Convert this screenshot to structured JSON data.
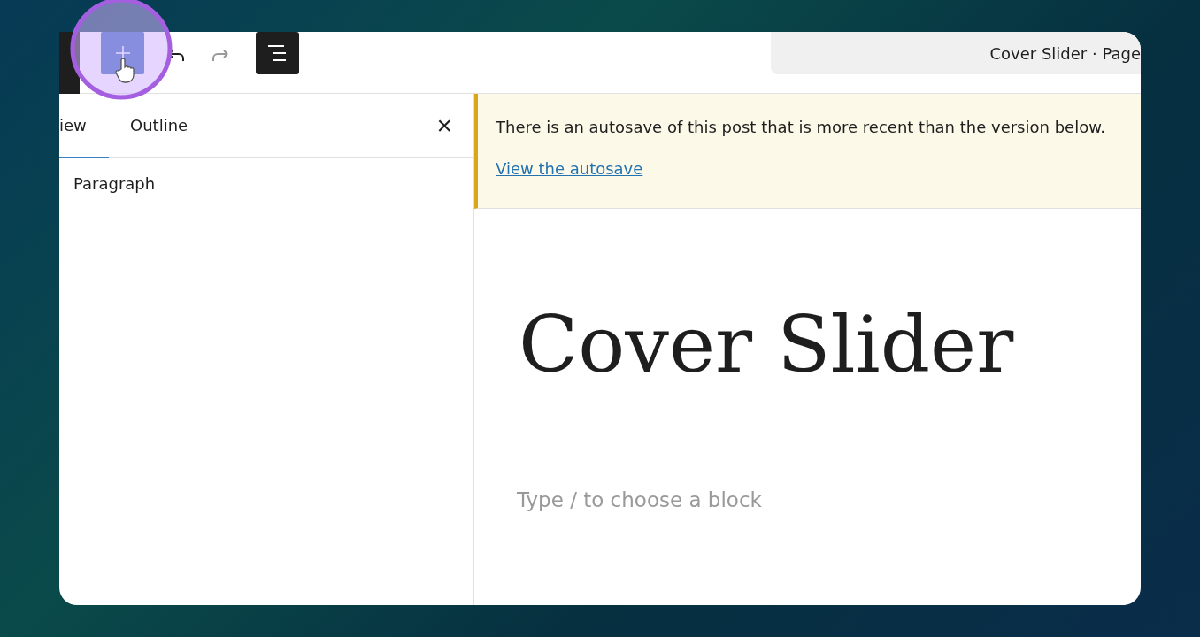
{
  "toolbar": {
    "document_title": "Cover Slider · Page"
  },
  "sidebar": {
    "tabs": [
      {
        "label": "iew",
        "selected": true
      },
      {
        "label": "Outline",
        "selected": false
      }
    ],
    "close": "×",
    "items": [
      {
        "label": "Paragraph"
      }
    ]
  },
  "notice": {
    "message": "There is an autosave of this post that is more recent than the version below.",
    "link": "View the autosave"
  },
  "editor": {
    "title": "Cover Slider",
    "placeholder": "Type / to choose a block"
  }
}
